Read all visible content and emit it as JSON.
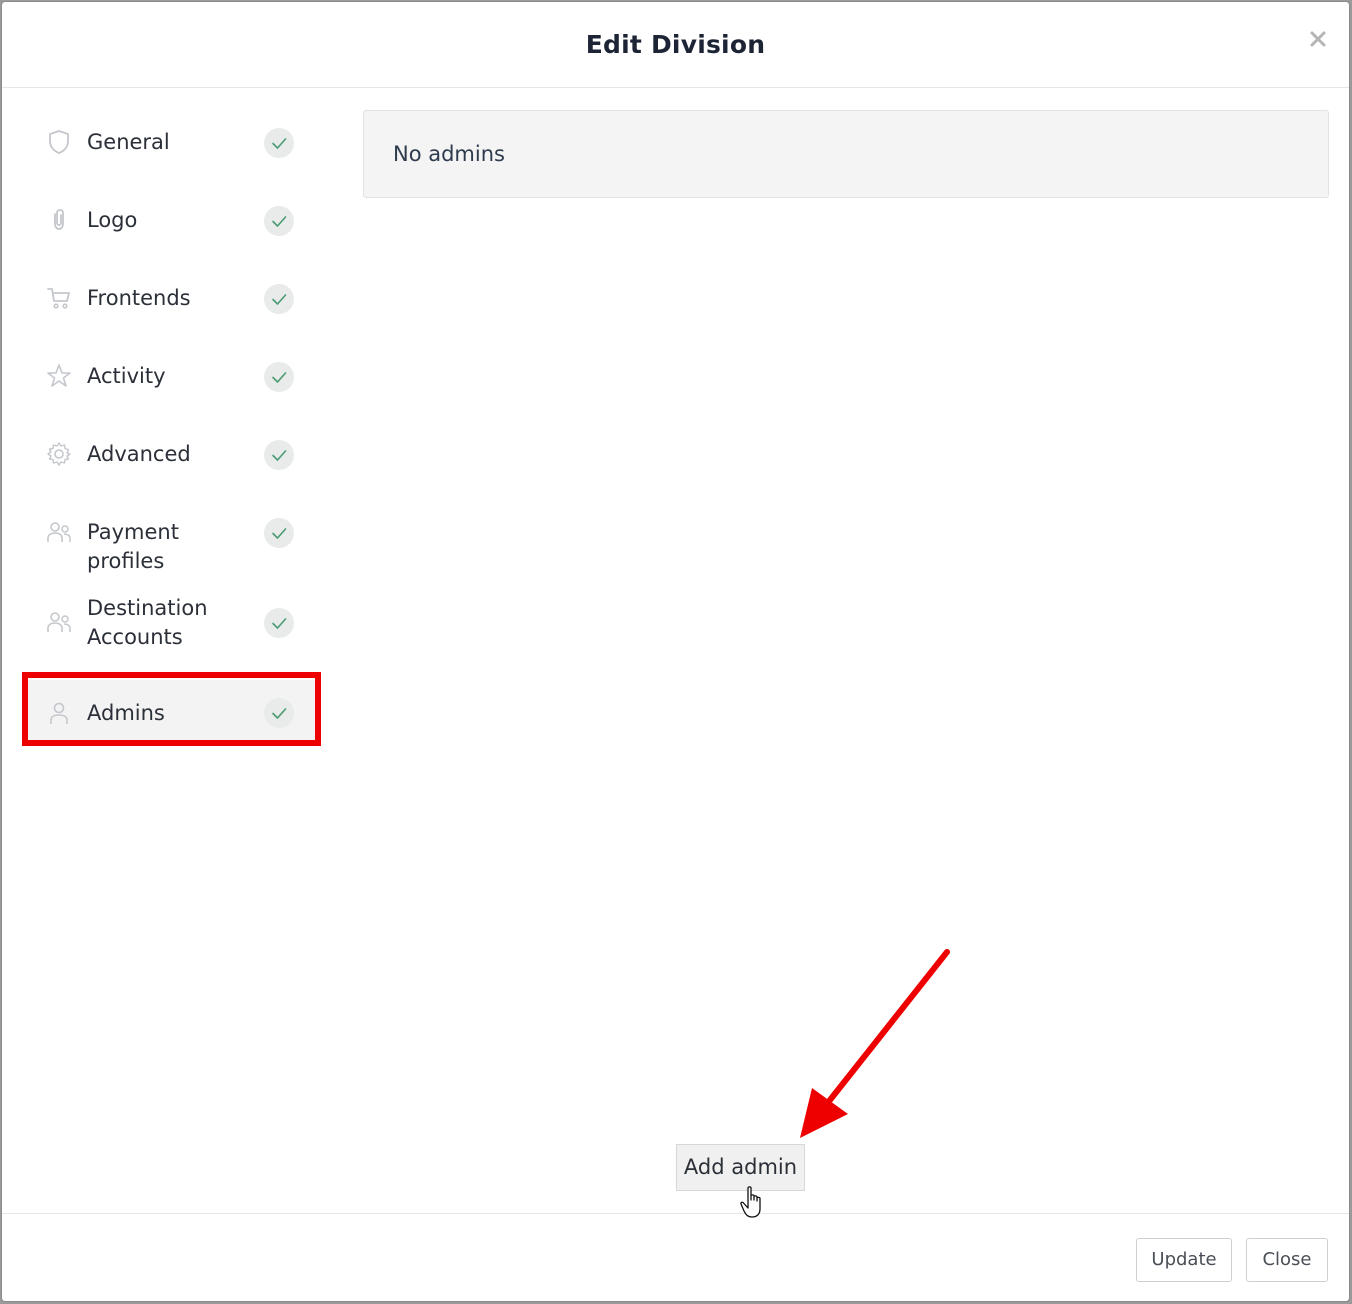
{
  "modal": {
    "title": "Edit Division",
    "close_icon": "close-icon"
  },
  "sidebar": {
    "items": [
      {
        "label": "General",
        "icon": "shield-icon",
        "status": "complete"
      },
      {
        "label": "Logo",
        "icon": "paperclip-icon",
        "status": "complete"
      },
      {
        "label": "Frontends",
        "icon": "cart-icon",
        "status": "complete"
      },
      {
        "label": "Activity",
        "icon": "star-icon",
        "status": "complete"
      },
      {
        "label": "Advanced",
        "icon": "gear-icon",
        "status": "complete"
      },
      {
        "label": "Payment profiles",
        "icon": "users-icon",
        "status": "complete"
      },
      {
        "label": "Destination Accounts",
        "icon": "users-icon",
        "status": "complete"
      },
      {
        "label": "Admins",
        "icon": "user-icon",
        "status": "complete",
        "active": true
      }
    ]
  },
  "main": {
    "empty_message": "No admins",
    "add_button_label": "Add admin"
  },
  "footer": {
    "update_label": "Update",
    "close_label": "Close"
  },
  "annotations": {
    "highlight_color": "#ee0000",
    "arrow_color": "#ee0000"
  }
}
